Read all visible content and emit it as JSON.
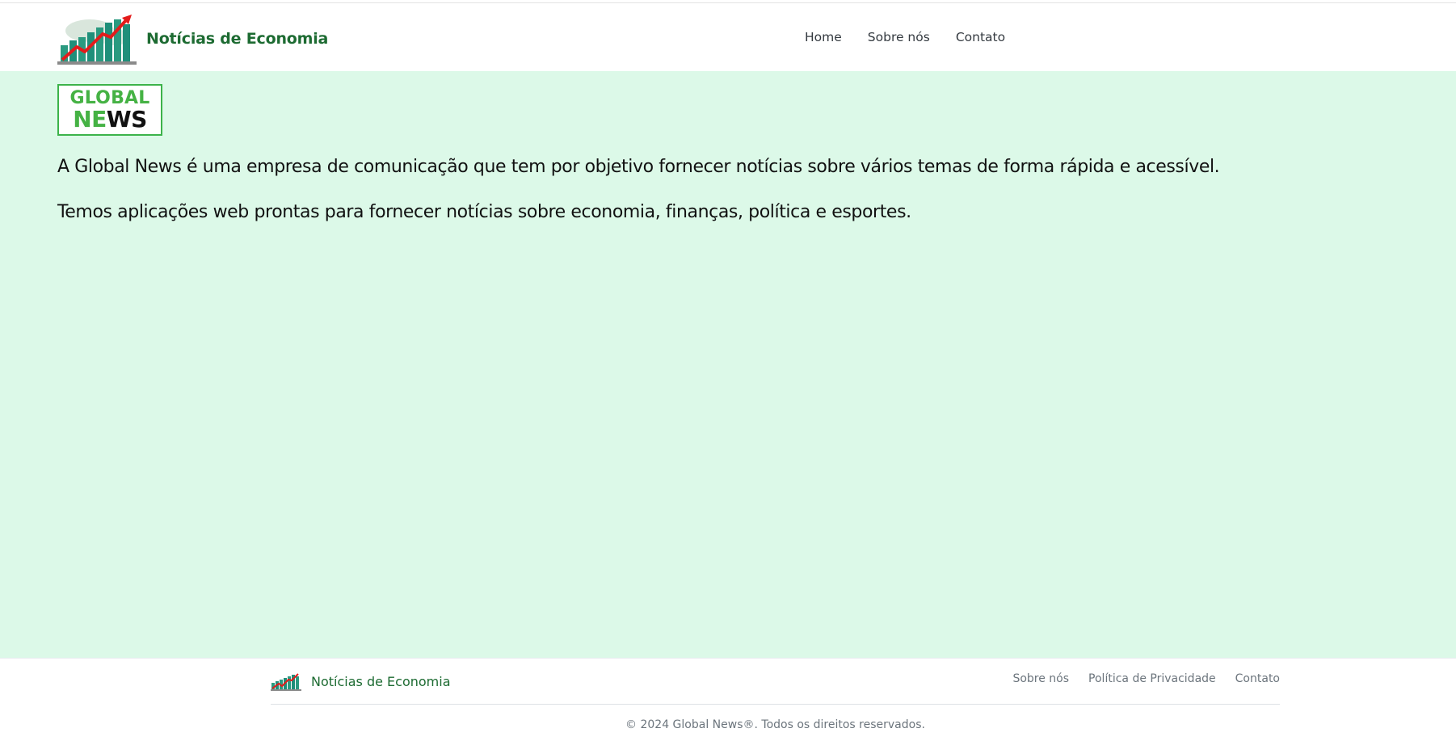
{
  "header": {
    "brand_name": "Notícias de Economia",
    "brand_logo_icon": "rising-chart-icon",
    "nav": [
      {
        "label": "Home"
      },
      {
        "label": "Sobre nós"
      },
      {
        "label": "Contato"
      }
    ]
  },
  "main": {
    "logo": {
      "top_text": "GLOBAL",
      "bottom_text_green": "NE",
      "bottom_text_black": "WS",
      "border_color": "#3cb34a"
    },
    "paragraphs": [
      "A Global News é uma empresa de comunicação que tem por objetivo fornecer notícias sobre vários temas de forma rápida e acessível.",
      "Temos aplicações web prontas para fornecer notícias sobre economia, finanças, política e esportes."
    ],
    "background_color": "#dcf9e8"
  },
  "footer": {
    "brand_name": "Notícias de Economia",
    "brand_logo_icon": "rising-chart-icon",
    "links": [
      {
        "label": "Sobre nós"
      },
      {
        "label": "Política de Privacidade"
      },
      {
        "label": "Contato"
      }
    ],
    "copyright": "© 2024 Global News®. Todos os direitos reservados."
  },
  "colors": {
    "brand_green": "#1d6b32",
    "accent_green": "#45b244",
    "chart_arrow_red": "#e31b1b",
    "chart_bar_teal": "#1f8f7a"
  }
}
